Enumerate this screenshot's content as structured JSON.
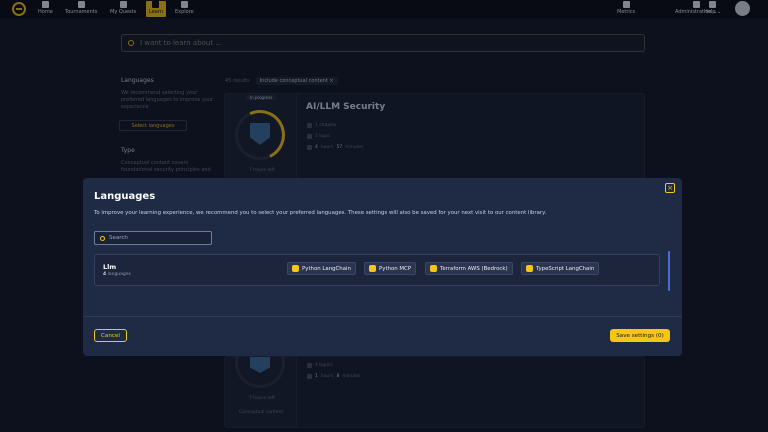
{
  "nav": {
    "items": [
      {
        "label": "Home",
        "icon": "home-icon"
      },
      {
        "label": "Tournaments",
        "icon": "trophy-icon"
      },
      {
        "label": "My Quests",
        "icon": "quests-icon"
      },
      {
        "label": "Learn",
        "icon": "learn-icon"
      },
      {
        "label": "Explore",
        "icon": "explore-icon"
      }
    ],
    "right": [
      {
        "label": "Metrics",
        "icon": "metrics-icon"
      },
      {
        "label": "Administration ⌄",
        "icon": "admin-icon"
      },
      {
        "label": "Help ⌄",
        "icon": "help-icon"
      }
    ]
  },
  "search": {
    "placeholder": "I want to learn about ..."
  },
  "sidebar": {
    "languages_title": "Languages",
    "languages_text": "We recommend selecting your preferred languages to improve your experience",
    "select_button": "Select languages",
    "type_title": "Type",
    "type_text": "Conceptual content covers foundational security principles and"
  },
  "filters": {
    "results": "45 results",
    "chip": "Include conceptual content ×"
  },
  "card1": {
    "status": "In progress",
    "title": "AI/LLM Security",
    "chapters": "1 chapter",
    "topics": "1 topic",
    "time_hours": "4",
    "time_hours_unit": "hours",
    "time_minutes": "57",
    "time_minutes_unit": "minutes",
    "hours_left": "7 hours left"
  },
  "card2": {
    "chapters": "4 topics",
    "time_hours": "1",
    "time_hours_unit": "hours",
    "time_minutes": "8",
    "time_minutes_unit": "minutes",
    "hours_left": "7 hours left",
    "content_type": "Conceptual content"
  },
  "modal": {
    "title": "Languages",
    "close": "×",
    "description": "To improve your learning experience, we recommend you to select your preferred languages. These settings will also be saved for your next visit to our content library.",
    "search_placeholder": "Search",
    "group": {
      "name": "Llm",
      "count": "4",
      "count_label": "languages"
    },
    "tags": [
      {
        "label": "Python LangChain",
        "icon": "python-icon",
        "color": "#f5c518"
      },
      {
        "label": "Python MCP",
        "icon": "python-icon",
        "color": "#f5c518"
      },
      {
        "label": "Terraform AWS (Bedrock)",
        "icon": "terraform-icon",
        "color": "#f5c518"
      },
      {
        "label": "TypeScript LangChain",
        "icon": "typescript-icon",
        "color": "#f5c518"
      }
    ],
    "cancel": "Cancel",
    "save": "Save settings (0)"
  },
  "colors": {
    "accent": "#f5c518",
    "modal_bg": "#1f2a44",
    "page_bg": "#14192a"
  }
}
